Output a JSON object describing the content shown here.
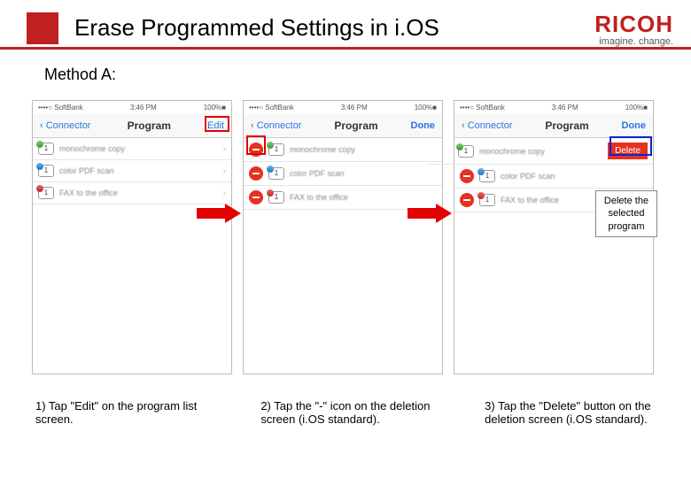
{
  "header": {
    "title": "Erase Programmed Settings in i.OS",
    "brand_name": "RICOH",
    "brand_tag": "imagine. change."
  },
  "subtitle": "Method A:",
  "status": {
    "carrier": "••••○ SoftBank",
    "time": "3:46 PM",
    "battery": "100%■"
  },
  "nav": {
    "back": "‹ Connector",
    "title": "Program",
    "edit": "Edit",
    "done": "Done"
  },
  "programs": [
    {
      "num": "1",
      "label": "monochrome copy"
    },
    {
      "num": "1",
      "label": "color PDF scan"
    },
    {
      "num": "1",
      "label": "FAX to the office"
    }
  ],
  "delete_label": "Delete",
  "callout": "Delete the selected program",
  "captions": {
    "c1": "1) Tap \"Edit\" on the program list screen.",
    "c2": "2) Tap the \"-\" icon on the deletion screen (i.OS standard).",
    "c3": "3) Tap the \"Delete\" button on the deletion screen (i.OS standard)."
  }
}
